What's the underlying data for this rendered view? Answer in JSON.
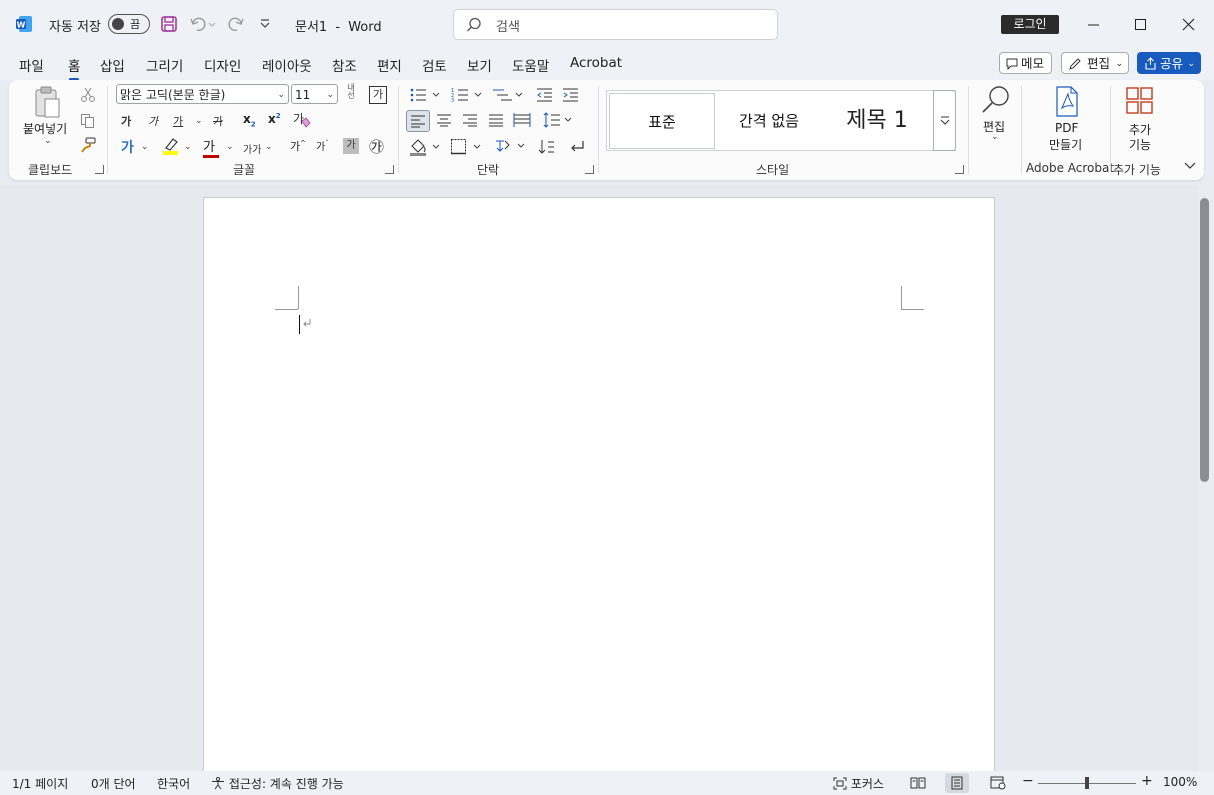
{
  "titlebar": {
    "autosave_label": "자동 저장",
    "autosave_state": "끔",
    "doc_title": "문서1",
    "separator": "-",
    "app_name": "Word",
    "search_placeholder": "검색",
    "login_label": "로그인"
  },
  "tabs": [
    "파일",
    "홈",
    "삽입",
    "그리기",
    "디자인",
    "레이아웃",
    "참조",
    "편지",
    "검토",
    "보기",
    "도움말",
    "Acrobat"
  ],
  "active_tab": "홈",
  "top_right": {
    "memo": "메모",
    "edit": "편집",
    "share": "공유"
  },
  "ribbon": {
    "clipboard": {
      "paste": "붙여넣기",
      "label": "클립보드"
    },
    "font": {
      "name": "맑은 고딕(본문 한글)",
      "size": "11",
      "label": "글꼴",
      "bold": "가",
      "italic": "가",
      "underline": "가",
      "strike": "가",
      "sub": "x",
      "sup": "x",
      "grow": "가",
      "shrink": "가",
      "phonetic": "내선",
      "charborder": "가",
      "shade": "가",
      "encircle": "㉮",
      "case": "가가"
    },
    "paragraph": {
      "label": "단락"
    },
    "styles": {
      "normal": "표준",
      "nospacing": "간격 없음",
      "heading1": "제목 1",
      "label": "스타일"
    },
    "editing": {
      "label": "편집"
    },
    "acrobat": {
      "create_pdf_line1": "PDF",
      "create_pdf_line2": "만들기",
      "label": "Adobe Acrobat"
    },
    "addins": {
      "line1": "추가",
      "line2": "기능",
      "label": "추가 기능"
    }
  },
  "status": {
    "page": "1/1 페이지",
    "words": "0개 단어",
    "language": "한국어",
    "accessibility": "접근성: 계속 진행 가능",
    "focus": "포커스",
    "zoom": "100%",
    "zoom_minus": "−",
    "zoom_plus": "+"
  },
  "colors": {
    "accent": "#185abd",
    "font_color": "#c00000",
    "highlight": "#ffff00",
    "save_icon": "#a33b9c"
  }
}
